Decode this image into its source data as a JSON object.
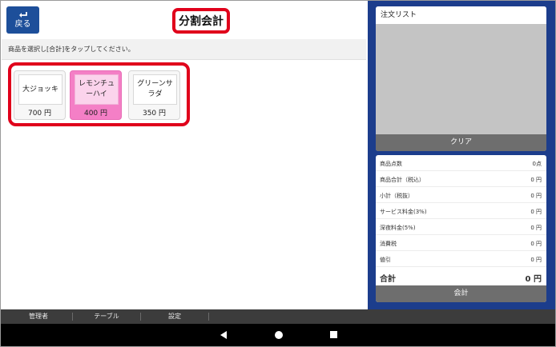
{
  "header": {
    "back_label": "戻る",
    "title": "分割会計"
  },
  "instruction": "商品を選択し[合計]をタップしてください。",
  "products": [
    {
      "name": "大ジョッキ",
      "price": "700 円",
      "selected": false
    },
    {
      "name": "レモンチュ\nーハイ",
      "price": "400 円",
      "selected": true
    },
    {
      "name": "グリーンサ\nラダ",
      "price": "350 円",
      "selected": false
    }
  ],
  "order_list": {
    "title": "注文リスト",
    "clear_label": "クリア"
  },
  "summary": {
    "rows": [
      {
        "label": "商品点数",
        "value": "0点"
      },
      {
        "label": "商品合計（税込）",
        "value": "0 円"
      },
      {
        "label": "小計（税抜）",
        "value": "0 円"
      },
      {
        "label": "サービス料金(3%)",
        "value": "0 円"
      },
      {
        "label": "深夜料金(5%)",
        "value": "0 円"
      },
      {
        "label": "消費税",
        "value": "0 円"
      },
      {
        "label": "値引",
        "value": "0 円"
      }
    ],
    "total_label": "合計",
    "total_value": "0 円",
    "pay_label": "会計"
  },
  "menubar": {
    "items": [
      "管理者",
      "テーブル",
      "設定"
    ]
  },
  "colors": {
    "accent_blue": "#1d4f9a",
    "panel_blue": "#1c3d8c",
    "highlight_red": "#e0001b",
    "selected_pink": "#f47fc6"
  }
}
